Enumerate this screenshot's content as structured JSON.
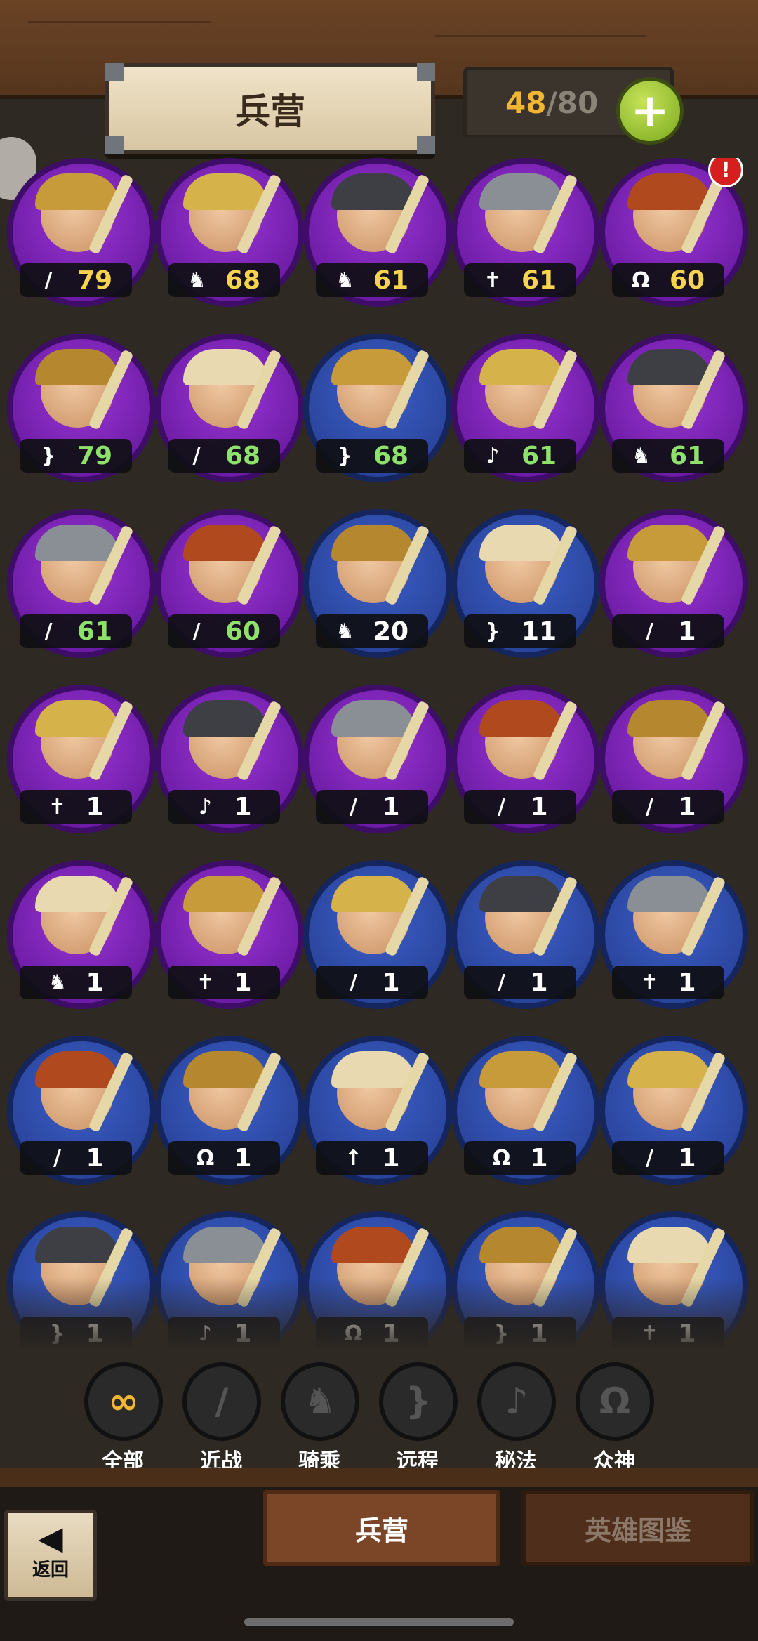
{
  "header": {
    "title": "兵营",
    "count_current": "48",
    "count_max": "/80",
    "add_button": "+"
  },
  "units": [
    {
      "class_icon": "sword",
      "class_glyph": "/",
      "level": "79",
      "level_color": "gold",
      "badge": "purple",
      "alert": false
    },
    {
      "class_icon": "horse",
      "class_glyph": "♞",
      "level": "68",
      "level_color": "gold",
      "badge": "purple",
      "alert": false
    },
    {
      "class_icon": "horse",
      "class_glyph": "♞",
      "level": "61",
      "level_color": "gold",
      "badge": "purple",
      "alert": false
    },
    {
      "class_icon": "cross",
      "class_glyph": "✝",
      "level": "61",
      "level_color": "gold",
      "badge": "purple",
      "alert": false
    },
    {
      "class_icon": "omega",
      "class_glyph": "Ω",
      "level": "60",
      "level_color": "gold",
      "badge": "purple",
      "alert": true
    },
    {
      "class_icon": "bow",
      "class_glyph": "}",
      "level": "79",
      "level_color": "green",
      "badge": "purple",
      "alert": false
    },
    {
      "class_icon": "sword",
      "class_glyph": "/",
      "level": "68",
      "level_color": "green",
      "badge": "purple",
      "alert": false
    },
    {
      "class_icon": "bow",
      "class_glyph": "}",
      "level": "68",
      "level_color": "green",
      "badge": "blue",
      "alert": false
    },
    {
      "class_icon": "magic",
      "class_glyph": "♪",
      "level": "61",
      "level_color": "green",
      "badge": "purple",
      "alert": false
    },
    {
      "class_icon": "horse",
      "class_glyph": "♞",
      "level": "61",
      "level_color": "green",
      "badge": "purple",
      "alert": false
    },
    {
      "class_icon": "sword",
      "class_glyph": "/",
      "level": "61",
      "level_color": "green",
      "badge": "purple",
      "alert": false
    },
    {
      "class_icon": "sword",
      "class_glyph": "/",
      "level": "60",
      "level_color": "green",
      "badge": "purple",
      "alert": false
    },
    {
      "class_icon": "horse",
      "class_glyph": "♞",
      "level": "20",
      "level_color": "white",
      "badge": "blue",
      "alert": false
    },
    {
      "class_icon": "bow",
      "class_glyph": "}",
      "level": "11",
      "level_color": "white",
      "badge": "blue",
      "alert": false
    },
    {
      "class_icon": "sword",
      "class_glyph": "/",
      "level": "1",
      "level_color": "white",
      "badge": "purple",
      "alert": false
    },
    {
      "class_icon": "cross",
      "class_glyph": "✝",
      "level": "1",
      "level_color": "white",
      "badge": "purple",
      "alert": false
    },
    {
      "class_icon": "magic",
      "class_glyph": "♪",
      "level": "1",
      "level_color": "white",
      "badge": "purple",
      "alert": false
    },
    {
      "class_icon": "sword",
      "class_glyph": "/",
      "level": "1",
      "level_color": "white",
      "badge": "purple",
      "alert": false
    },
    {
      "class_icon": "sword",
      "class_glyph": "/",
      "level": "1",
      "level_color": "white",
      "badge": "purple",
      "alert": false
    },
    {
      "class_icon": "sword",
      "class_glyph": "/",
      "level": "1",
      "level_color": "white",
      "badge": "purple",
      "alert": false
    },
    {
      "class_icon": "horse",
      "class_glyph": "♞",
      "level": "1",
      "level_color": "white",
      "badge": "purple",
      "alert": false
    },
    {
      "class_icon": "cross",
      "class_glyph": "✝",
      "level": "1",
      "level_color": "white",
      "badge": "purple",
      "alert": false
    },
    {
      "class_icon": "sword",
      "class_glyph": "/",
      "level": "1",
      "level_color": "white",
      "badge": "blue",
      "alert": false
    },
    {
      "class_icon": "sword",
      "class_glyph": "/",
      "level": "1",
      "level_color": "white",
      "badge": "blue",
      "alert": false
    },
    {
      "class_icon": "cross",
      "class_glyph": "✝",
      "level": "1",
      "level_color": "white",
      "badge": "blue",
      "alert": false
    },
    {
      "class_icon": "sword",
      "class_glyph": "/",
      "level": "1",
      "level_color": "white",
      "badge": "blue",
      "alert": false
    },
    {
      "class_icon": "omega",
      "class_glyph": "Ω",
      "level": "1",
      "level_color": "white",
      "badge": "blue",
      "alert": false
    },
    {
      "class_icon": "spear",
      "class_glyph": "↑",
      "level": "1",
      "level_color": "white",
      "badge": "blue",
      "alert": false
    },
    {
      "class_icon": "omega",
      "class_glyph": "Ω",
      "level": "1",
      "level_color": "white",
      "badge": "blue",
      "alert": false
    },
    {
      "class_icon": "sword",
      "class_glyph": "/",
      "level": "1",
      "level_color": "white",
      "badge": "blue",
      "alert": false
    },
    {
      "class_icon": "bow",
      "class_glyph": "}",
      "level": "1",
      "level_color": "white",
      "badge": "blue",
      "alert": false
    },
    {
      "class_icon": "magic",
      "class_glyph": "♪",
      "level": "1",
      "level_color": "white",
      "badge": "blue",
      "alert": false
    },
    {
      "class_icon": "omega",
      "class_glyph": "Ω",
      "level": "1",
      "level_color": "white",
      "badge": "blue",
      "alert": false
    },
    {
      "class_icon": "bow",
      "class_glyph": "}",
      "level": "1",
      "level_color": "white",
      "badge": "blue",
      "alert": false
    },
    {
      "class_icon": "cross",
      "class_glyph": "✝",
      "level": "1",
      "level_color": "white",
      "badge": "blue",
      "alert": false
    }
  ],
  "alert_mark": "!",
  "filters": [
    {
      "label": "全部",
      "glyph": "∞",
      "icon": "infinity-icon",
      "active": true
    },
    {
      "label": "近战",
      "glyph": "/",
      "icon": "sword-icon",
      "active": false
    },
    {
      "label": "骑乘",
      "glyph": "♞",
      "icon": "horse-icon",
      "active": false
    },
    {
      "label": "远程",
      "glyph": "}",
      "icon": "bow-icon",
      "active": false
    },
    {
      "label": "秘法",
      "glyph": "♪",
      "icon": "magic-icon",
      "active": false
    },
    {
      "label": "众神",
      "glyph": "Ω",
      "icon": "omega-icon",
      "active": false
    }
  ],
  "bottom": {
    "back_arrow": "◀",
    "back_label": "返回",
    "tab_barracks": "兵营",
    "tab_codex": "英雄图鉴"
  },
  "colors": {
    "gold": "#f6d44d",
    "green": "#8ee16a",
    "purple_badge": "#7a22b8",
    "blue_badge": "#2f4aa8",
    "plus": "#9cc831"
  }
}
